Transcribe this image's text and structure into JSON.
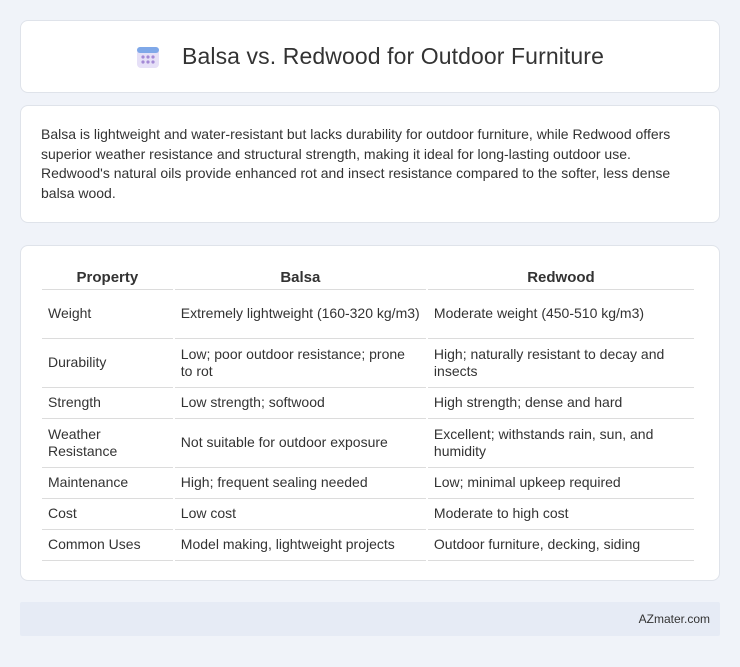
{
  "header": {
    "title": "Balsa vs. Redwood for Outdoor Furniture",
    "icon": "calendar-icon"
  },
  "summary": "Balsa is lightweight and water-resistant but lacks durability for outdoor furniture, while Redwood offers superior weather resistance and structural strength, making it ideal for long-lasting outdoor use. Redwood's natural oils provide enhanced rot and insect resistance compared to the softer, less dense balsa wood.",
  "table": {
    "headers": [
      "Property",
      "Balsa",
      "Redwood"
    ],
    "rows": [
      [
        "Weight",
        "Extremely lightweight (160-320 kg/m3)",
        "Moderate weight (450-510 kg/m3)"
      ],
      [
        "Durability",
        "Low; poor outdoor resistance; prone to rot",
        "High; naturally resistant to decay and insects"
      ],
      [
        "Strength",
        "Low strength; softwood",
        "High strength; dense and hard"
      ],
      [
        "Weather Resistance",
        "Not suitable for outdoor exposure",
        "Excellent; withstands rain, sun, and humidity"
      ],
      [
        "Maintenance",
        "High; frequent sealing needed",
        "Low; minimal upkeep required"
      ],
      [
        "Cost",
        "Low cost",
        "Moderate to high cost"
      ],
      [
        "Common Uses",
        "Model making, lightweight projects",
        "Outdoor furniture, decking, siding"
      ]
    ]
  },
  "footer": {
    "brand": "AZmater.com"
  }
}
